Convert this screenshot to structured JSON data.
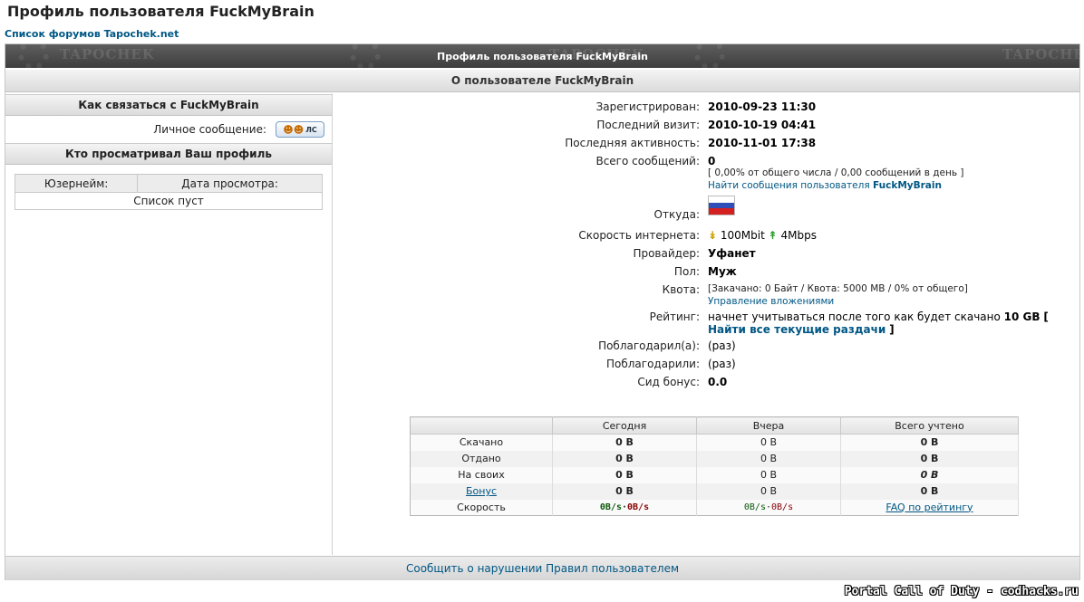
{
  "page": {
    "title": "Профиль пользователя FuckMyBrain",
    "forum_link": "Список форумов Tapochek.net"
  },
  "top_bar": {
    "title": "Профиль пользователя FuckMyBrain",
    "watermark": "TAPOCHEK"
  },
  "about_bar": {
    "title": "О пользователе FuckMyBrain"
  },
  "contact": {
    "header": "Как связаться с FuckMyBrain",
    "pm_label": "Личное сообщение:",
    "pm_button": "ЛС"
  },
  "views": {
    "header": "Кто просматривал Ваш профиль",
    "col_user": "Юзернейм:",
    "col_date": "Дата просмотра:",
    "empty": "Список пуст"
  },
  "profile": {
    "registered_label": "Зарегистрирован:",
    "registered": "2010-09-23 11:30",
    "last_visit_label": "Последний визит:",
    "last_visit": "2010-10-19 04:41",
    "last_activity_label": "Последняя активность:",
    "last_activity": "2010-11-01 17:38",
    "posts_label": "Всего сообщений:",
    "posts": "0",
    "posts_stats": "[ 0,00% от общего числа / 0,00 сообщений в день ]",
    "posts_link_prefix": "Найти сообщения пользователя ",
    "posts_link_user": "FuckMyBrain",
    "from_label": "Откуда:",
    "speed_label": "Скорость интернета:",
    "speed_down": "100Mbit",
    "speed_up": "4Mbps",
    "provider_label": "Провайдер:",
    "provider": "Уфанет",
    "gender_label": "Пол:",
    "gender": "Муж",
    "quota_label": "Квота:",
    "quota": "[Закачано: 0 Байт / Квота: 5000 MB / 0% от общего]",
    "quota_link": "Управление вложениями",
    "rating_label": "Рейтинг:",
    "rating_text": "начнет учитываться после того как будет скачано ",
    "rating_amount": "10 GB",
    "rating_bracket_open": "[",
    "rating_link": "Найти все текущие раздачи",
    "rating_bracket_close": "]",
    "thanked_label": "Поблагодарил(а):",
    "thanked": "(раз)",
    "thanked_by_label": "Поблагодарили:",
    "thanked_by": "(раз)",
    "seed_bonus_label": "Сид бонус:",
    "seed_bonus": "0.0"
  },
  "stats": {
    "headers": [
      "",
      "Сегодня",
      "Вчера",
      "Всего учтено"
    ],
    "rows": [
      {
        "label": "Скачано",
        "today": "0 B",
        "yesterday": "0 B",
        "total": "0 B"
      },
      {
        "label": "Отдано",
        "today": "0 B",
        "yesterday": "0 B",
        "total": "0 B"
      },
      {
        "label": "На своих",
        "today": "0 B",
        "yesterday": "0 B",
        "total": "0 B"
      },
      {
        "label": "Бонус",
        "today": "0 B",
        "yesterday": "0 B",
        "total": "0 B"
      }
    ],
    "speed_row": {
      "label": "Скорость",
      "today_down": "0B/s",
      "today_up": "0B/s",
      "yest_down": "0B/s",
      "yest_up": "0B/s",
      "total": "FAQ по рейтингу"
    },
    "sep": "·"
  },
  "footer": {
    "report_link": "Сообщить о нарушении Правил пользователем",
    "watermark": "Portal Call of Duty - codhacks.ru"
  },
  "colors": {
    "link": "#005784",
    "down_red": "#8a0000",
    "up_green": "#0a5a0a",
    "bonus_green": "#2a7a00"
  }
}
